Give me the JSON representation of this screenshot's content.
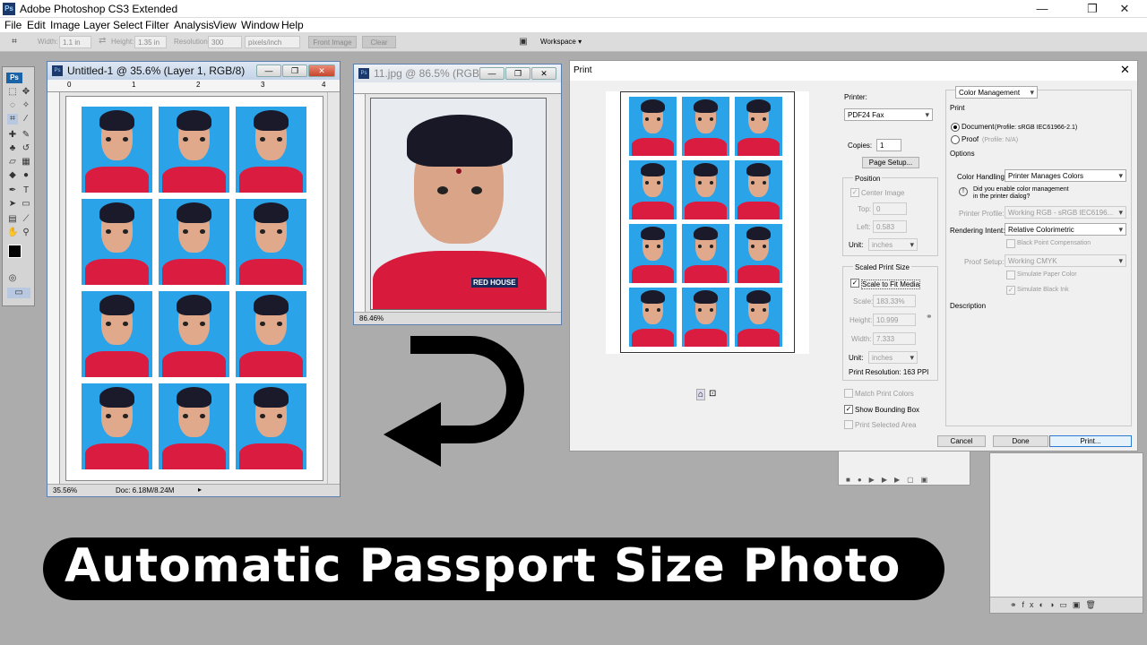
{
  "app": {
    "title": "Adobe Photoshop CS3 Extended",
    "ps_icon": "Ps"
  },
  "window_controls": {
    "minimize": "—",
    "restore": "❐",
    "close": "✕"
  },
  "menu": [
    "File",
    "Edit",
    "Image",
    "Layer",
    "Select",
    "Filter",
    "Analysis",
    "View",
    "Window",
    "Help"
  ],
  "options_bar": {
    "width_label": "Width:",
    "width_value": "1.1 in",
    "height_label": "Height:",
    "height_value": "1.35 in",
    "resolution_label": "Resolution:",
    "resolution_value": "300",
    "resolution_unit": "pixels/inch",
    "front_image": "Front Image",
    "clear": "Clear",
    "workspace": "Workspace ▾"
  },
  "toolbox": {
    "logo": "Ps"
  },
  "doc1": {
    "title": "Untitled-1 @ 35.6% (Layer 1, RGB/8)",
    "zoom": "35.56%",
    "doc_size": "Doc: 6.18M/8.24M",
    "ruler_marks": [
      "0",
      "1",
      "2",
      "3",
      "4"
    ]
  },
  "doc2": {
    "title": "11.jpg @ 86.5% (RGB/8)",
    "zoom": "86.46%",
    "shirt_text": "RED HOUSE"
  },
  "print_dialog": {
    "title": "Print",
    "printer_label": "Printer:",
    "printer_value": "PDF24 Fax",
    "copies_label": "Copies:",
    "copies_value": "1",
    "page_setup": "Page Setup...",
    "position_label": "Position",
    "center_image": "Center Image",
    "top_label": "Top:",
    "top_value": "0",
    "left_label": "Left:",
    "left_value": "0.583",
    "unit_label": "Unit:",
    "unit_value": "inches",
    "scaled_label": "Scaled Print Size",
    "scale_to_fit": "Scale to Fit Media",
    "scale_label": "Scale:",
    "scale_value": "183.33%",
    "height_label": "Height:",
    "height_value": "10.999",
    "width_label": "Width:",
    "width_value": "7.333",
    "unit2_label": "Unit:",
    "unit2_value": "inches",
    "print_resolution": "Print Resolution: 163 PPI",
    "match_colors": "Match Print Colors",
    "show_bbox": "Show Bounding Box",
    "print_selected": "Print Selected Area",
    "color_mgmt": "Color Management",
    "print_section": "Print",
    "document_label": "Document",
    "document_profile": "(Profile: sRGB IEC61966-2.1)",
    "proof_label": "Proof",
    "proof_profile": "(Profile: N/A)",
    "options_label": "Options",
    "color_handling_label": "Color Handling:",
    "color_handling_value": "Printer Manages Colors",
    "warn_text_1": "Did you enable color management",
    "warn_text_2": "in the printer dialog?",
    "printer_profile_label": "Printer Profile:",
    "printer_profile_value": "Working RGB - sRGB IEC6196...",
    "rendering_label": "Rendering Intent:",
    "rendering_value": "Relative Colorimetric",
    "bpc": "Black Point Compensation",
    "proof_setup_label": "Proof Setup:",
    "proof_setup_value": "Working CMYK",
    "sim_paper": "Simulate Paper Color",
    "sim_black": "Simulate Black Ink",
    "description_label": "Description",
    "cancel": "Cancel",
    "done": "Done",
    "print": "Print..."
  },
  "banner": {
    "text": "Automatic Passport Size Photo"
  },
  "colors": {
    "photo_bg": "#2aa3e8",
    "shirt": "#d91c3f",
    "accent": "#1b62a6"
  }
}
